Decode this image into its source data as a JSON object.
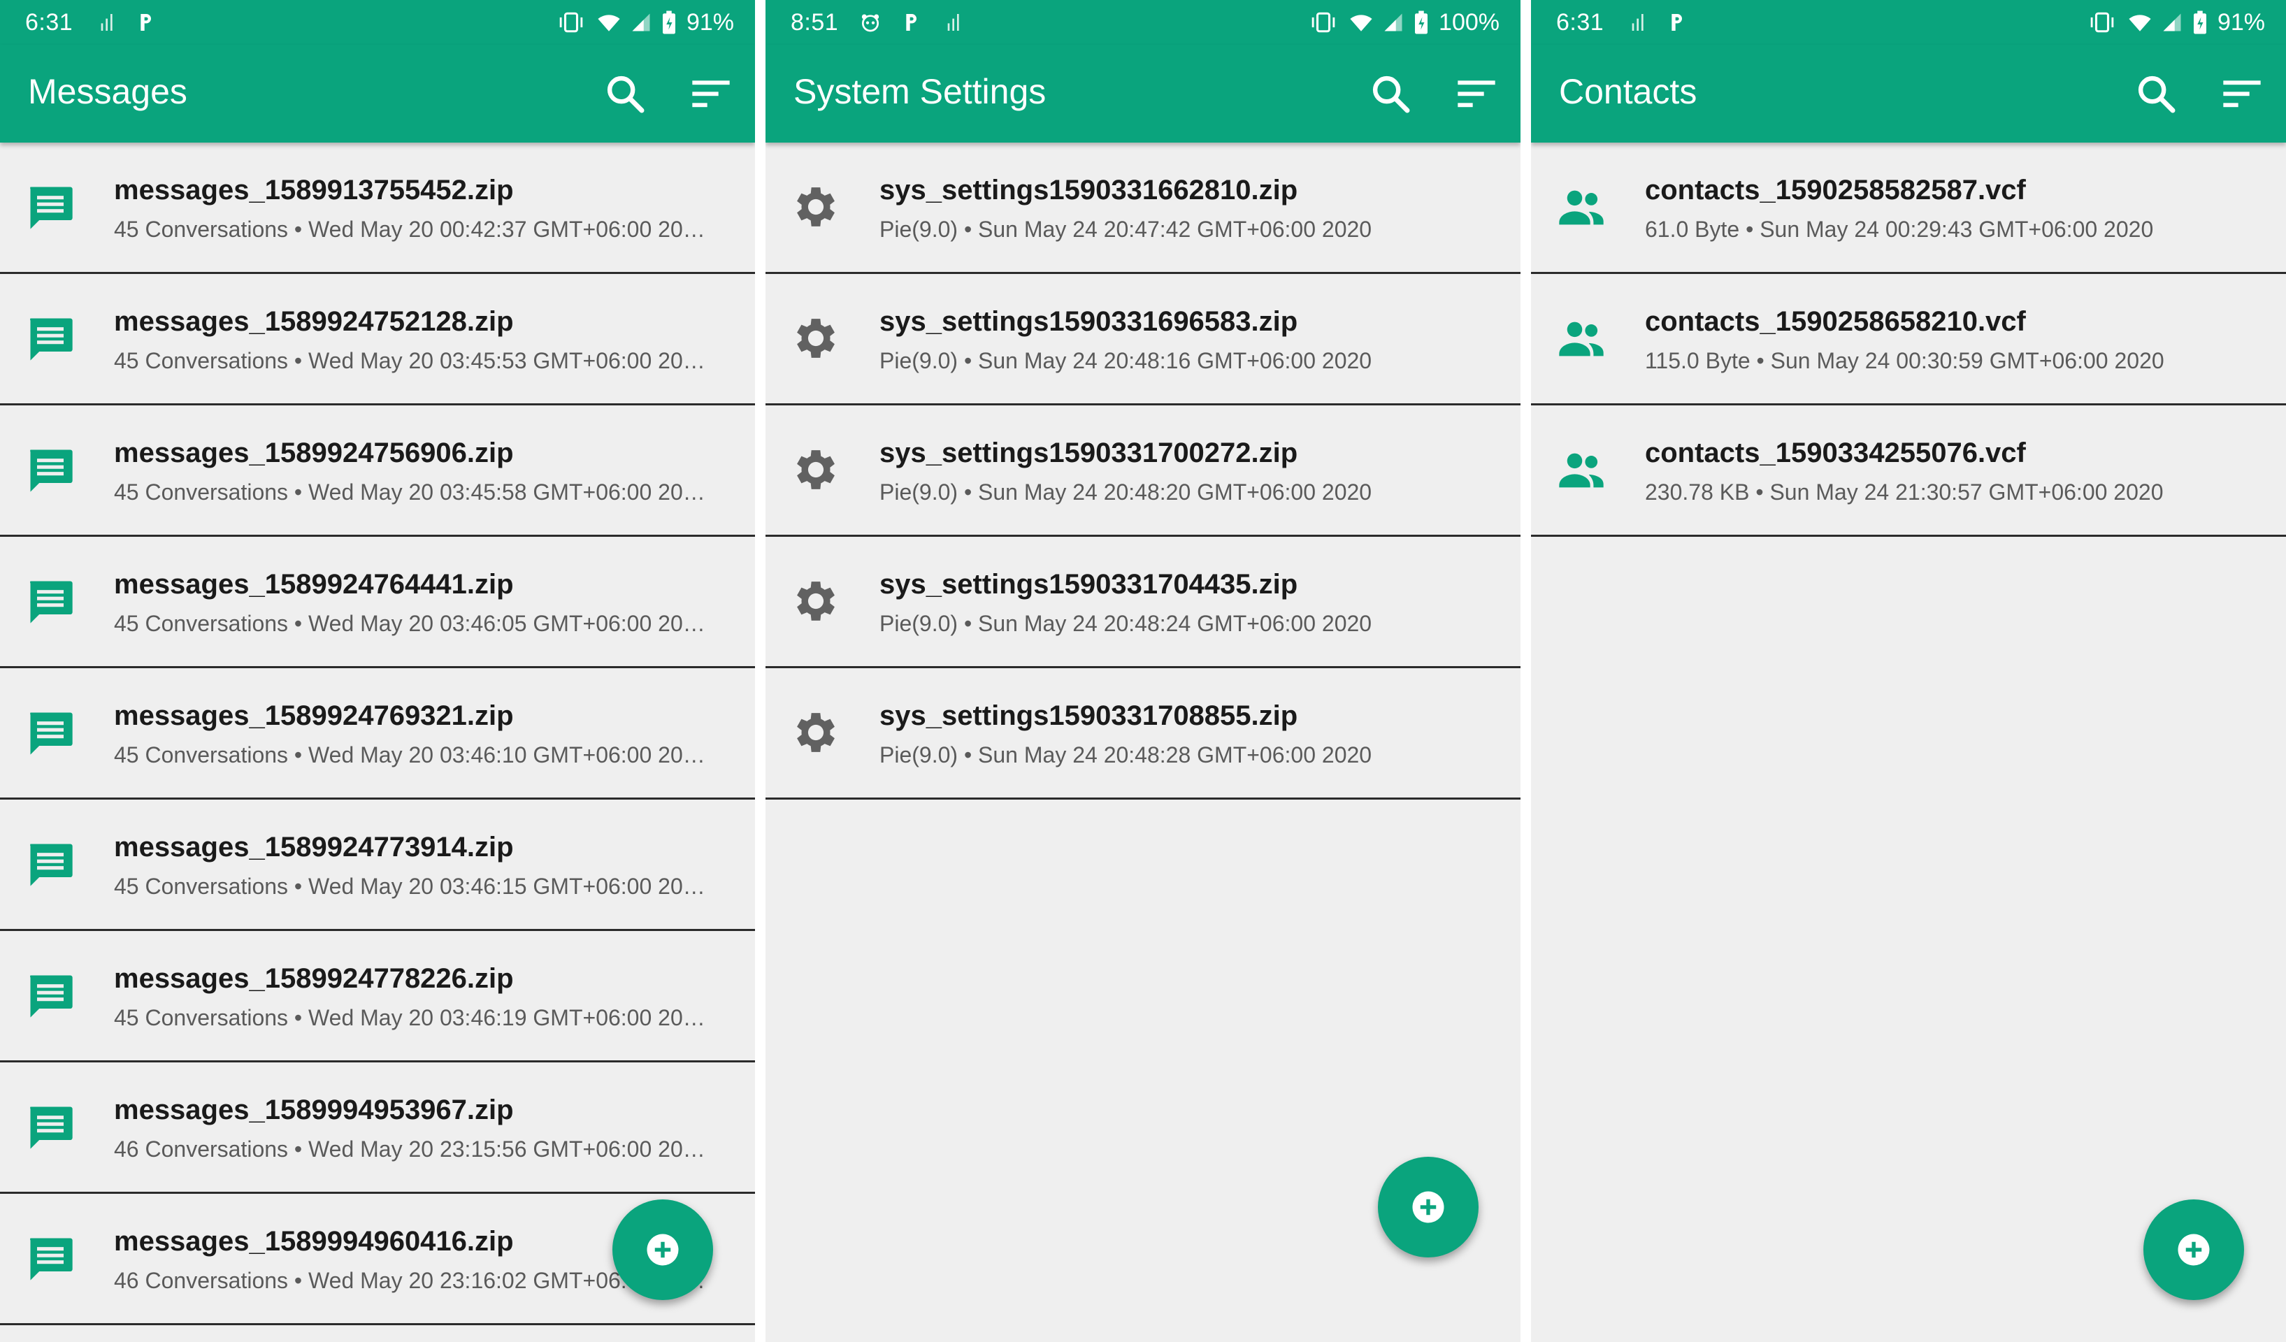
{
  "colors": {
    "primary": "#0aa47d",
    "background": "#efefef",
    "divider": "#2b2b2b"
  },
  "panels": [
    {
      "status": {
        "time": "6:31",
        "battery": "91%"
      },
      "title": "Messages",
      "icon": "message-icon",
      "items": [
        {
          "name": "messages_1589913755452.zip",
          "detail": "45 Conversations • Wed May 20 00:42:37 GMT+06:00 20…"
        },
        {
          "name": "messages_1589924752128.zip",
          "detail": "45 Conversations • Wed May 20 03:45:53 GMT+06:00 20…"
        },
        {
          "name": "messages_1589924756906.zip",
          "detail": "45 Conversations • Wed May 20 03:45:58 GMT+06:00 20…"
        },
        {
          "name": "messages_1589924764441.zip",
          "detail": "45 Conversations • Wed May 20 03:46:05 GMT+06:00 20…"
        },
        {
          "name": "messages_1589924769321.zip",
          "detail": "45 Conversations • Wed May 20 03:46:10 GMT+06:00 20…"
        },
        {
          "name": "messages_1589924773914.zip",
          "detail": "45 Conversations • Wed May 20 03:46:15 GMT+06:00 20…"
        },
        {
          "name": "messages_1589924778226.zip",
          "detail": "45 Conversations • Wed May 20 03:46:19 GMT+06:00 20…"
        },
        {
          "name": "messages_1589994953967.zip",
          "detail": "46 Conversations • Wed May 20 23:15:56 GMT+06:00 20…"
        },
        {
          "name": "messages_1589994960416.zip",
          "detail": "46 Conversations • Wed May 20 23:16:02 GMT+06:00 20…"
        }
      ]
    },
    {
      "status": {
        "time": "8:51",
        "battery": "100%"
      },
      "title": "System Settings",
      "icon": "gear-icon",
      "items": [
        {
          "name": "sys_settings1590331662810.zip",
          "detail": "Pie(9.0) • Sun May 24 20:47:42 GMT+06:00 2020"
        },
        {
          "name": "sys_settings1590331696583.zip",
          "detail": "Pie(9.0) • Sun May 24 20:48:16 GMT+06:00 2020"
        },
        {
          "name": "sys_settings1590331700272.zip",
          "detail": "Pie(9.0) • Sun May 24 20:48:20 GMT+06:00 2020"
        },
        {
          "name": "sys_settings1590331704435.zip",
          "detail": "Pie(9.0) • Sun May 24 20:48:24 GMT+06:00 2020"
        },
        {
          "name": "sys_settings1590331708855.zip",
          "detail": "Pie(9.0) • Sun May 24 20:48:28 GMT+06:00 2020"
        }
      ]
    },
    {
      "status": {
        "time": "6:31",
        "battery": "91%"
      },
      "title": "Contacts",
      "icon": "people-icon",
      "items": [
        {
          "name": "contacts_1590258582587.vcf",
          "detail": "61.0 Byte • Sun May 24 00:29:43 GMT+06:00 2020"
        },
        {
          "name": "contacts_1590258658210.vcf",
          "detail": "115.0 Byte • Sun May 24 00:30:59 GMT+06:00 2020"
        },
        {
          "name": "contacts_1590334255076.vcf",
          "detail": "230.78 KB • Sun May 24 21:30:57 GMT+06:00 2020"
        }
      ]
    }
  ]
}
